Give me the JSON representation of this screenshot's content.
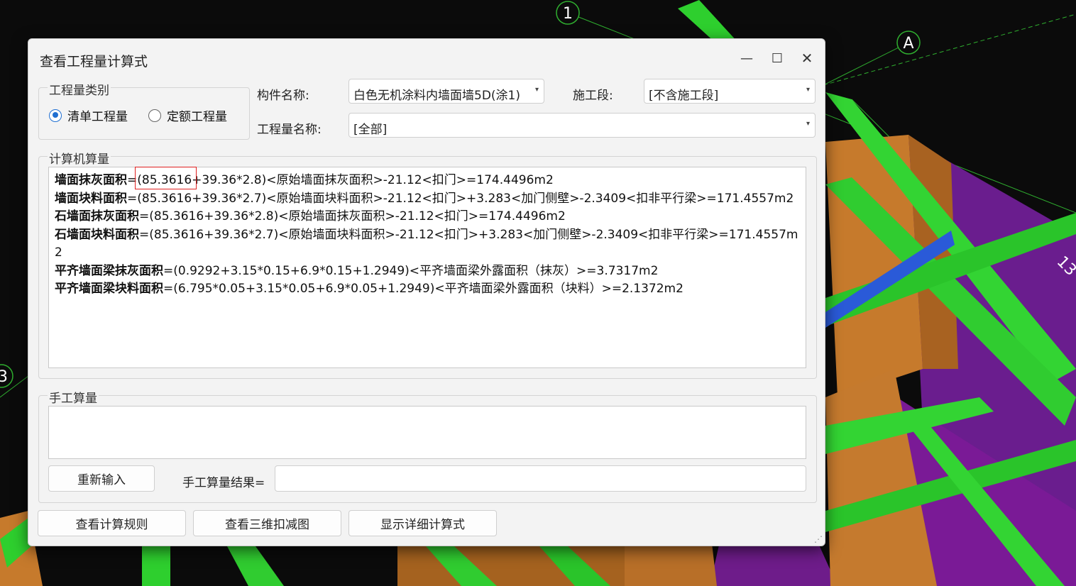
{
  "background": {
    "axis_labels": [
      "1",
      "A",
      "3",
      "13"
    ]
  },
  "dialog": {
    "title": "查看工程量计算式",
    "window_buttons": {
      "minimize": "—",
      "maximize": "☐",
      "close": "✕"
    },
    "quantity_type": {
      "legend": "工程量类别",
      "options": [
        {
          "label": "清单工程量",
          "checked": true
        },
        {
          "label": "定额工程量",
          "checked": false
        }
      ]
    },
    "component": {
      "label": "构件名称:",
      "value": "白色无机涂料内墙面墙5D(涂1)"
    },
    "construction_stage": {
      "label": "施工段:",
      "value": "[不含施工段]"
    },
    "quantity_name": {
      "label": "工程量名称:",
      "value": "[全部]"
    },
    "computer_calc": {
      "legend": "计算机算量",
      "lines": [
        {
          "name": "墙面抹灰面积",
          "expr": "=(85.3616+39.36*2.8)<原始墙面抹灰面积>-21.12<扣门>=174.4496m2"
        },
        {
          "name": "墙面块料面积",
          "expr": "=(85.3616+39.36*2.7)<原始墙面块料面积>-21.12<扣门>+3.283<加门侧壁>-2.3409<扣非平行梁>=171.4557m2"
        },
        {
          "name": "石墙面抹灰面积",
          "expr": "=(85.3616+39.36*2.8)<原始墙面抹灰面积>-21.12<扣门>=174.4496m2"
        },
        {
          "name": "石墙面块料面积",
          "expr": "=(85.3616+39.36*2.7)<原始墙面块料面积>-21.12<扣门>+3.283<加门侧壁>-2.3409<扣非平行梁>=171.4557m2"
        },
        {
          "name": "平齐墙面梁抹灰面积",
          "expr": "=(0.9292+3.15*0.15+6.9*0.15+1.2949)<平齐墙面梁外露面积（抹灰）>=3.7317m2"
        },
        {
          "name": "平齐墙面梁块料面积",
          "expr": "=(6.795*0.05+3.15*0.05+6.9*0.05+1.2949)<平齐墙面梁外露面积（块料）>=2.1372m2"
        }
      ]
    },
    "manual_calc": {
      "legend": "手工算量",
      "text": "",
      "reenter_button": "重新输入",
      "result_label": "手工算量结果=",
      "result_value": ""
    },
    "buttons": {
      "view_rules": "查看计算规则",
      "view_3d": "查看三维扣减图",
      "show_detail": "显示详细计算式"
    }
  }
}
